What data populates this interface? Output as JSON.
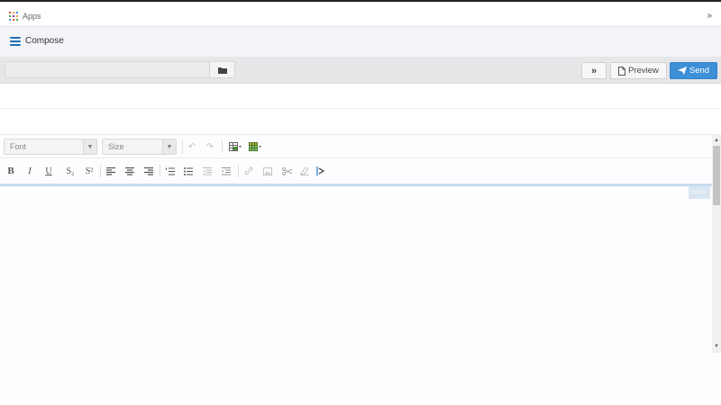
{
  "top_bar": {
    "apps_label": "Apps",
    "collapse_glyph": "»",
    "apps_grid_colors": [
      "#e4572e",
      "#f2a541",
      "#3d8fd6",
      "#4caf50",
      "#9c27b0",
      "#f2a541",
      "#3d8fd6",
      "#e4572e",
      "#4caf50"
    ]
  },
  "header": {
    "title": "Compose",
    "menu_icon": "hamburger-icon"
  },
  "action_bar": {
    "subject_value": "",
    "subject_placeholder": "",
    "folder_icon": "folder-icon",
    "expand_glyph": "»",
    "preview_label": "Preview",
    "send_label": "Send",
    "send_color": "#3d8fd6"
  },
  "editor_toolbar": {
    "font_placeholder": "Font",
    "size_placeholder": "Size",
    "undo_glyph": "↶",
    "redo_glyph": "↷",
    "bold": "B",
    "italic": "I",
    "underline": "U",
    "subscript": "S₂",
    "superscript": "S²"
  },
  "editor": {
    "body_text": "",
    "header_tag": "header"
  }
}
